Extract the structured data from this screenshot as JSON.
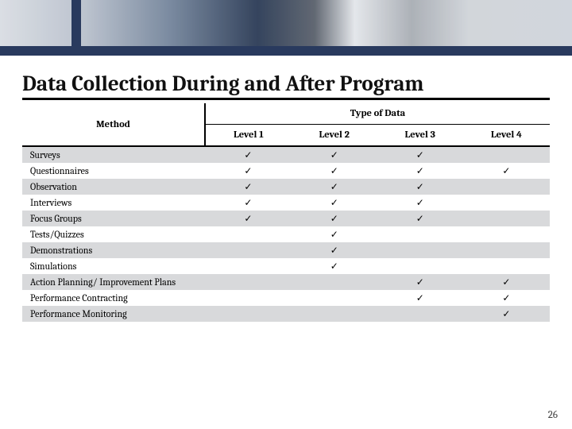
{
  "title": "Data Collection During and After Program",
  "headers": {
    "method": "Method",
    "type": "Type of Data",
    "levels": [
      "Level 1",
      "Level 2",
      "Level 3",
      "Level 4"
    ]
  },
  "check": "✓",
  "rows": [
    {
      "method": "Surveys",
      "levels": [
        true,
        true,
        true,
        false
      ],
      "shade": true
    },
    {
      "method": "Questionnaires",
      "levels": [
        true,
        true,
        true,
        true
      ],
      "shade": false
    },
    {
      "method": "Observation",
      "levels": [
        true,
        true,
        true,
        false
      ],
      "shade": true
    },
    {
      "method": "Interviews",
      "levels": [
        true,
        true,
        true,
        false
      ],
      "shade": false
    },
    {
      "method": "Focus Groups",
      "levels": [
        true,
        true,
        true,
        false
      ],
      "shade": true
    },
    {
      "method": "Tests/Quizzes",
      "levels": [
        false,
        true,
        false,
        false
      ],
      "shade": false
    },
    {
      "method": "Demonstrations",
      "levels": [
        false,
        true,
        false,
        false
      ],
      "shade": true
    },
    {
      "method": "Simulations",
      "levels": [
        false,
        true,
        false,
        false
      ],
      "shade": false
    },
    {
      "method": "Action Planning/ Improvement Plans",
      "levels": [
        false,
        false,
        true,
        true
      ],
      "shade": true
    },
    {
      "method": "Performance Contracting",
      "levels": [
        false,
        false,
        true,
        true
      ],
      "shade": false
    },
    {
      "method": "Performance Monitoring",
      "levels": [
        false,
        false,
        false,
        true
      ],
      "shade": true
    }
  ],
  "page_number": "26"
}
